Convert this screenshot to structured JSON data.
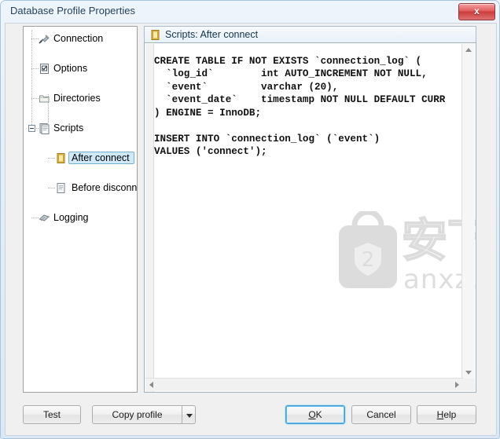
{
  "window": {
    "title": "Database Profile Properties",
    "close_icon": "close-icon",
    "close_label": "x"
  },
  "sidebar": {
    "items": [
      {
        "label": "Connection",
        "icon": "plug-icon",
        "indent": 0,
        "selected": false
      },
      {
        "label": "Options",
        "icon": "checkbox-doc-icon",
        "indent": 0,
        "selected": false
      },
      {
        "label": "Directories",
        "icon": "folder-icon",
        "indent": 0,
        "selected": false
      },
      {
        "label": "Scripts",
        "icon": "scripts-icon",
        "indent": 0,
        "selected": false,
        "expanded": true
      },
      {
        "label": "After connect",
        "icon": "yellow-doc-icon",
        "indent": 1,
        "selected": true
      },
      {
        "label": "Before disconnec",
        "icon": "gray-doc-icon",
        "indent": 1,
        "selected": false
      },
      {
        "label": "Logging",
        "icon": "logging-icon",
        "indent": 0,
        "selected": false
      }
    ]
  },
  "editor": {
    "header_label": "Scripts: After connect",
    "header_icon": "yellow-doc-icon",
    "code": "CREATE TABLE IF NOT EXISTS `connection_log` (\n  `log_id`        int AUTO_INCREMENT NOT NULL,\n  `event`         varchar (20),\n  `event_date`    timestamp NOT NULL DEFAULT CURR\n) ENGINE = InnoDB;\n\nINSERT INTO `connection_log` (`event`)\nVALUES ('connect');",
    "scroll_up_icon": "scroll-up-arrow-icon",
    "scroll_down_icon": "scroll-down-arrow-icon",
    "scroll_left_icon": "scroll-left-arrow-icon",
    "scroll_right_icon": "scroll-right-arrow-icon"
  },
  "watermark": {
    "chinese": "安下载",
    "latin": "anxz.com",
    "logo_icon": "shield-bag-icon"
  },
  "buttons": {
    "test": "Test",
    "copy_profile": "Copy profile",
    "copy_profile_dropdown_icon": "chevron-down-icon",
    "ok": "OK",
    "cancel": "Cancel",
    "help": "Help"
  },
  "colors": {
    "title_text": "#26425f",
    "selection": "#cfe8fa",
    "default_button_border": "#3c9bd4",
    "close_button": "#cc3b3b"
  }
}
